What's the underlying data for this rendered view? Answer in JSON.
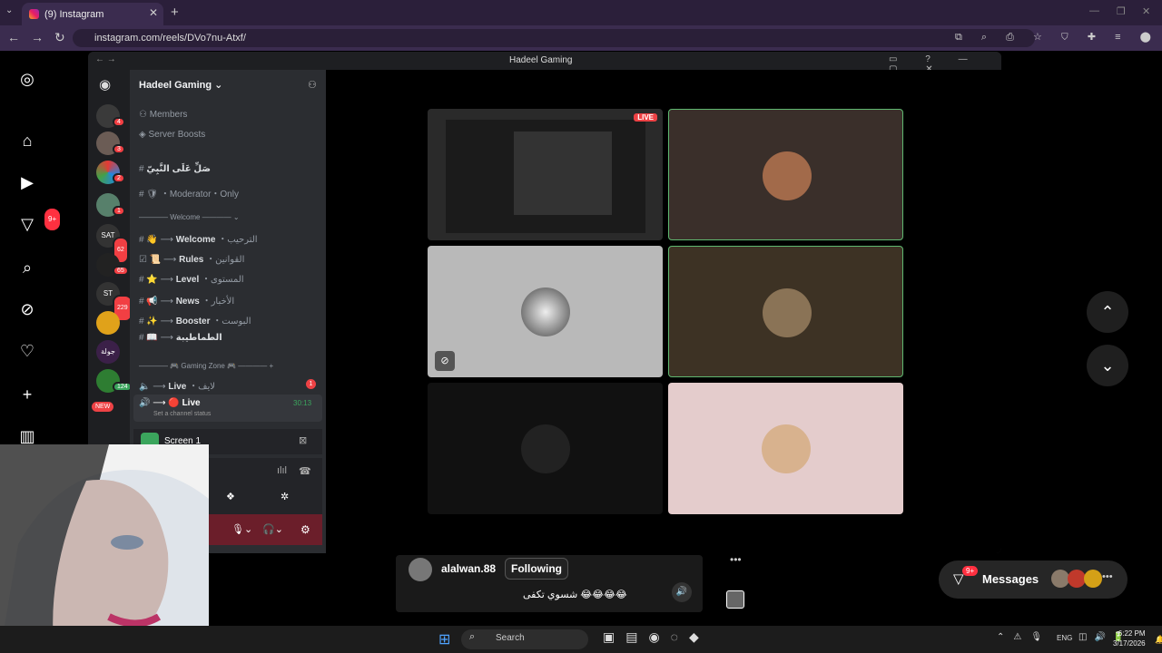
{
  "browser": {
    "tab_title": "(9) Instagram",
    "url": "instagram.com/reels/DVo7nu-Atxf/"
  },
  "instagram": {
    "notif_badge": "9+",
    "reel": {
      "username": "alalwan.88",
      "follow_label": "Following",
      "caption": "شسوي تكفى 😂😂😂😂"
    },
    "messages": {
      "label": "Messages",
      "badge": "9+"
    }
  },
  "discord": {
    "window_title": "Hadeel Gaming",
    "server_name": "Hadeel Gaming",
    "menu": {
      "members": "Members",
      "boosts": "Server Boosts"
    },
    "server_badges": [
      "4",
      "3",
      "2",
      "1",
      "62",
      "65",
      "229",
      "",
      "",
      "124",
      "NEW"
    ],
    "channels": [
      {
        "name": "صَلِّ عَلَى النَّبِيّ"
      },
      {
        "name": "・Moderator・Only"
      }
    ],
    "welcome_category": "Welcome",
    "welcome_channels": [
      {
        "name": "Welcome",
        "ar": "الترحيب"
      },
      {
        "name": "Rules",
        "ar": "القوانين"
      },
      {
        "name": "Level",
        "ar": "المستوى"
      },
      {
        "name": "News",
        "ar": "الأخبار"
      },
      {
        "name": "Booster",
        "ar": "البوست"
      },
      {
        "name": "",
        "ar": "الطماطيبة"
      }
    ],
    "gaming_category": "Gaming Zone",
    "voice": [
      {
        "name": "Live",
        "ar": "لايف",
        "badge": "1"
      },
      {
        "name": "Live",
        "timer": "30:13",
        "status": "Set a channel status"
      }
    ],
    "screen_label": "Screen 1",
    "live_badge": "LIVE"
  },
  "taskbar": {
    "search": "Search",
    "lang": "ENG",
    "time": "6:22 PM",
    "date": "3/17/2026"
  }
}
